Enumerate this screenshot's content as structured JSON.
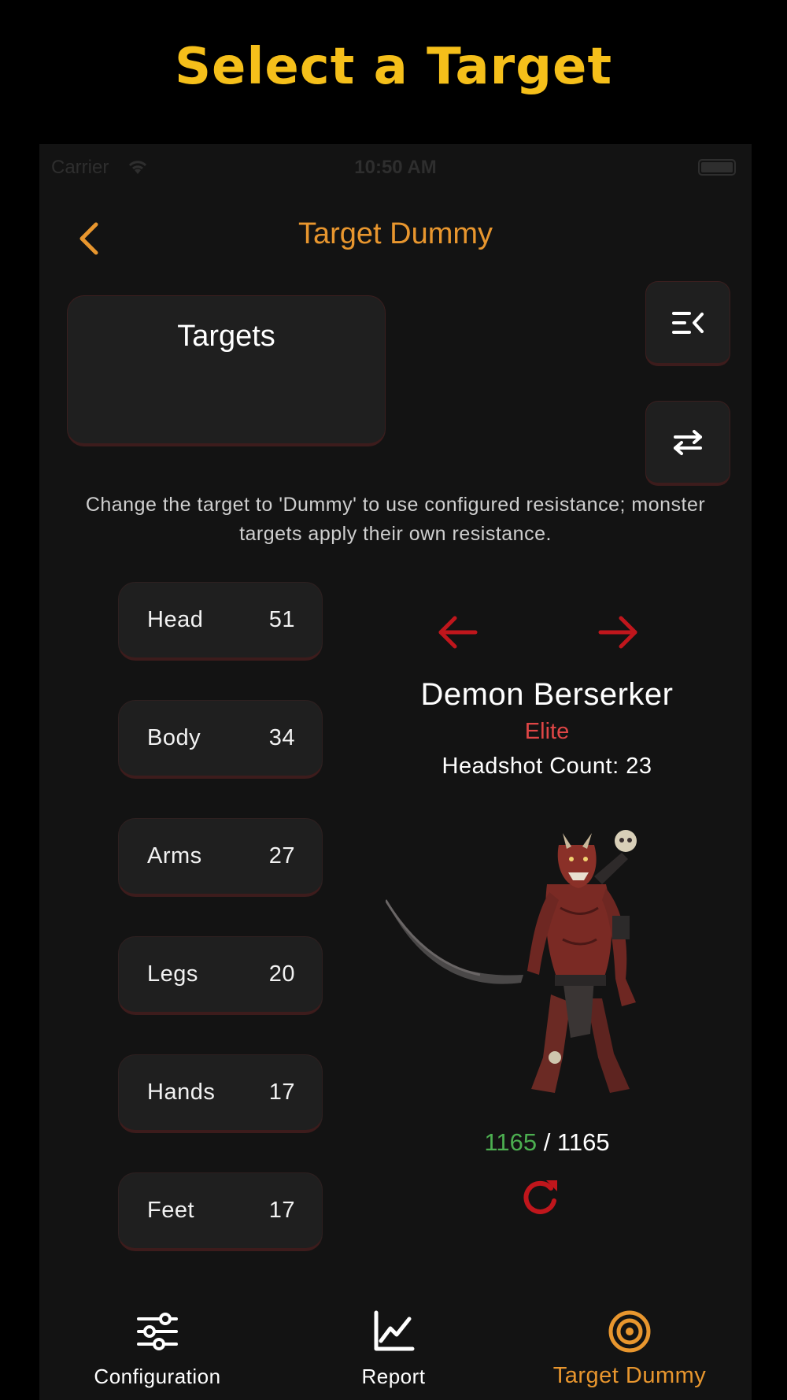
{
  "headline": "Select a Target",
  "status_bar": {
    "carrier": "Carrier",
    "time": "10:50 AM"
  },
  "nav": {
    "title": "Target Dummy"
  },
  "targets_card": {
    "label": "Targets"
  },
  "info_text": "Change the target to 'Dummy' to use configured resistance; monster targets apply their own resistance.",
  "body_parts": [
    {
      "name": "Head",
      "value": "51"
    },
    {
      "name": "Body",
      "value": "34"
    },
    {
      "name": "Arms",
      "value": "27"
    },
    {
      "name": "Legs",
      "value": "20"
    },
    {
      "name": "Hands",
      "value": "17"
    },
    {
      "name": "Feet",
      "value": "17"
    }
  ],
  "monster": {
    "name": "Demon Berserker",
    "rank": "Elite",
    "headshot": "Headshot Count: 23",
    "hp_current": "1165",
    "hp_separator": " / ",
    "hp_max": "1165"
  },
  "tabs": [
    {
      "label": "Configuration",
      "icon": "sliders-icon"
    },
    {
      "label": "Report",
      "icon": "chart-line-icon"
    },
    {
      "label": "Target Dummy",
      "icon": "target-icon"
    }
  ],
  "colors": {
    "headline": "#f5bf1a",
    "accent": "#e8962e",
    "danger": "#c0161c",
    "rank": "#e04646",
    "hp": "#4caf50"
  }
}
